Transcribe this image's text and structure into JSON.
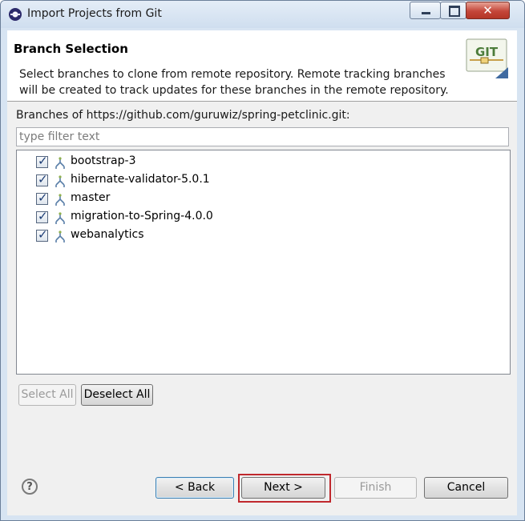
{
  "window": {
    "title": "Import Projects from Git",
    "controls": {
      "minimize": "minimize-icon",
      "maximize": "maximize-icon",
      "close": "close-icon",
      "close_glyph": "✕"
    }
  },
  "header": {
    "title": "Branch Selection",
    "description": "Select branches to clone from remote repository. Remote tracking branches will be created to track updates for these branches in the remote repository.",
    "logo_text": "GIT"
  },
  "branches": {
    "label": "Branches of https://github.com/guruwiz/spring-petclinic.git:",
    "filter_placeholder": "type filter text",
    "items": [
      {
        "label": "bootstrap-3",
        "checked": true
      },
      {
        "label": "hibernate-validator-5.0.1",
        "checked": true
      },
      {
        "label": "master",
        "checked": true
      },
      {
        "label": "migration-to-Spring-4.0.0",
        "checked": true
      },
      {
        "label": "webanalytics",
        "checked": true
      }
    ],
    "check_glyph": "✓"
  },
  "selection_buttons": {
    "select_all": "Select All",
    "deselect_all": "Deselect All"
  },
  "footer": {
    "help": "?",
    "back": "< Back",
    "next": "Next >",
    "finish": "Finish",
    "cancel": "Cancel"
  },
  "colors": {
    "highlight": "#c0282d",
    "titlebar": "#d7e4f2",
    "close": "#c4463a"
  }
}
